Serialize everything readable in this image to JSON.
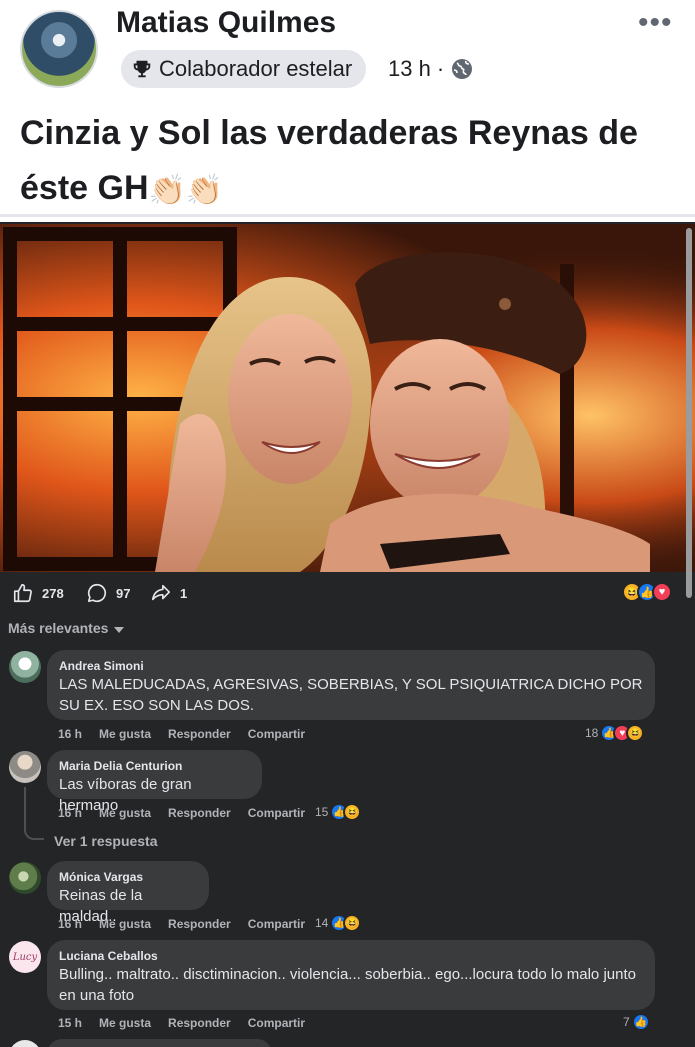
{
  "post": {
    "author": "Matias Quilmes",
    "badge": "Colaborador estelar",
    "time": "13 h ·",
    "text": "Cinzia y Sol las verdaderas Reynas de éste GH",
    "emoji": "👏🏻👏🏻",
    "more_icon": "•••"
  },
  "stats": {
    "likes": "278",
    "comments": "97",
    "shares": "1"
  },
  "sort_label": "Más relevantes",
  "comments": [
    {
      "name": "Andrea Simoni",
      "text": "LAS MALEDUCADAS, AGRESIVAS, SOBERBIAS, Y SOL PSIQUIATRICA DICHO POR SU EX. ESO SON LAS DOS.",
      "time": "16 h",
      "like": "Me gusta",
      "reply": "Responder",
      "share": "Compartir",
      "reactions": "18"
    },
    {
      "name": "Maria Delia Centurion",
      "text": "Las víboras de gran hermano",
      "time": "16 h",
      "like": "Me gusta",
      "reply": "Responder",
      "share": "Compartir",
      "reactions": "15",
      "replies_link": "Ver 1 respuesta"
    },
    {
      "name": "Mónica Vargas",
      "text": "Reinas de la maldad..",
      "time": "16 h",
      "like": "Me gusta",
      "reply": "Responder",
      "share": "Compartir",
      "reactions": "14"
    },
    {
      "name": "Luciana Ceballos",
      "text": "Bulling.. maltrato.. disctiminacion.. violencia... soberbia.. ego...locura todo lo malo junto en una foto",
      "time": "15 h",
      "like": "Me gusta",
      "reply": "Responder",
      "share": "Compartir",
      "reactions": "7",
      "avatar_text": "Lucy"
    }
  ],
  "colors": {
    "background": "#242526",
    "bubble": "#3a3b3c",
    "like_blue": "#1877f2",
    "love_red": "#f33e58",
    "haha_yellow": "#f7b125"
  }
}
